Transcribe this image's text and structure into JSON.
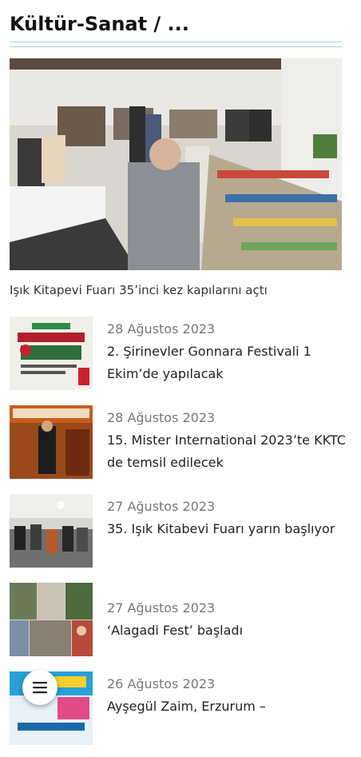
{
  "header": {
    "title": "Kültür-Sanat / ..."
  },
  "featured": {
    "title": "Işık Kitapevi Fuarı 35’inci kez kapılarını açtı",
    "image_icon": "book-fair-photo"
  },
  "articles": [
    {
      "date": "28 Ağustos 2023",
      "title": "2. Şirinevler Gonnara Festivali 1 Ekim’de yapılacak",
      "thumb_icon": "festival-poster-thumbnail"
    },
    {
      "date": "28 Ağustos 2023",
      "title": "15. Mister International 2023’te KKTC de temsil edilecek",
      "thumb_icon": "stage-photo-thumbnail"
    },
    {
      "date": "27 Ağustos 2023",
      "title": "35. Işık Kitabevi Fuarı yarın başlıyor",
      "thumb_icon": "book-fair-thumbnail"
    },
    {
      "date": "27 Ağustos 2023",
      "title": "‘Alagadi Fest’ başladı",
      "thumb_icon": "collage-thumbnail"
    },
    {
      "date": "26 Ağustos 2023",
      "title": "Ayşegül Zaim, Erzurum –",
      "thumb_icon": "poster-thumbnail"
    }
  ],
  "fab": {
    "icon": "menu-icon"
  }
}
